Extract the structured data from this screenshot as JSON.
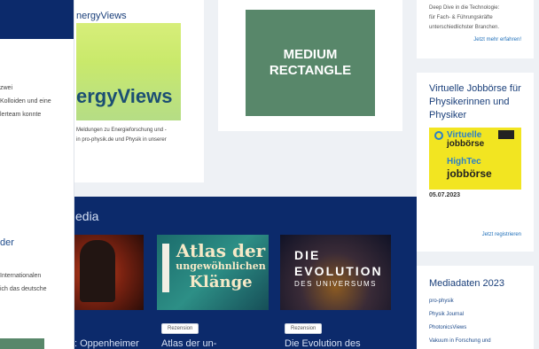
{
  "left_panel": {
    "text_block_1": [
      "zwei",
      "Kolloiden und eine",
      "lerteam konnte"
    ],
    "title_2": "der",
    "text_block_2": [
      "Internationalen",
      "ich das deutsche"
    ]
  },
  "energyviews": {
    "title": "nergyViews",
    "image_text": "ergyViews",
    "description": [
      "Meldungen zu Energieforschung und -",
      "in pro-physik.de und Physik in unserer"
    ]
  },
  "medium_rectangle": {
    "line1": "MEDIUM",
    "line2": "RECTANGLE"
  },
  "media": {
    "title": "edia",
    "books": [
      {
        "title": ": Oppenheimer",
        "tag": ""
      },
      {
        "title": "Atlas der un-",
        "tag": "Rezension",
        "cover_line1": "Atlas der",
        "cover_line2": "ungewöhnlichen",
        "cover_line3": "Klänge"
      },
      {
        "title": "Die Evolution des",
        "tag": "Rezension",
        "cover_line1": "DIE",
        "cover_line2": "EVOLUTION",
        "cover_line3": "DES UNIVERSUMS"
      }
    ]
  },
  "deep_dive": {
    "text": [
      "Deep Dive in die Technologie:",
      "für Fach- & Führungskräfte",
      "unterschiedlichster Branchen."
    ],
    "link": "Jetzt mehr erfahren!"
  },
  "jobboerse": {
    "title": "Virtuelle Jobbörse für Physikerinnen und Physiker",
    "image_lines": [
      "Virtuelle",
      "jobbörse",
      "HighTec",
      "jobbörse"
    ],
    "date": "05.07.2023",
    "link": "Jetzt registrieren"
  },
  "mediadaten": {
    "title": "Mediadaten 2023",
    "items": [
      "pro-physik",
      "Physik Journal",
      "PhotonicsViews",
      "Vakuum in Forschung und"
    ]
  },
  "colors": {
    "navy": "#0c2a6b",
    "green": "#58876a",
    "link": "#1f6fb9",
    "job_yellow": "#f2e521"
  }
}
